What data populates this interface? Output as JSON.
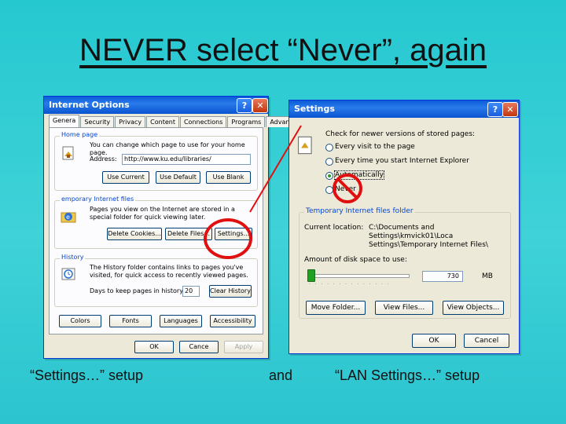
{
  "slide": {
    "title": "NEVER select “Never”, again",
    "captions": [
      "“Settings…”  setup",
      "and",
      "“LAN Settings…” setup"
    ]
  },
  "internet_options": {
    "title": "Internet Options",
    "help": "?",
    "close": "✕",
    "tabs": [
      "Genera",
      "Security",
      "Privacy",
      "Content",
      "Connections",
      "Programs",
      "Advanced"
    ],
    "home_page": {
      "label": "Home page",
      "text": "You can change which page to use for your home page.",
      "address_label": "Address:",
      "address_value": "http://www.ku.edu/libraries/",
      "buttons": [
        "Use Current",
        "Use Default",
        "Use Blank"
      ]
    },
    "temp_files": {
      "label": "emporary Internet files",
      "text": "Pages you view on the Internet are stored in a special folder for quick viewing later.",
      "buttons": [
        "Delete Cookies...",
        "Delete Files...",
        "Settings..."
      ]
    },
    "history": {
      "label": "History",
      "text": "The History folder contains links to pages you've visited, for quick access to recently viewed pages.",
      "days_label": "Days to keep pages in history:",
      "days_value": "20",
      "clear_button": "Clear History"
    },
    "bottom_buttons": [
      "Colors",
      "Fonts",
      "Languages",
      "Accessibility"
    ],
    "dialog_buttons": {
      "ok": "OK",
      "cancel": "Cance",
      "apply": "Apply"
    }
  },
  "settings": {
    "title": "Settings",
    "help": "?",
    "close": "✕",
    "check_label": "Check for newer versions of stored pages:",
    "options": [
      "Every visit to the page",
      "Every time you start Internet Explorer",
      "Automatically",
      "Never"
    ],
    "selected": "Automatically",
    "temp_group": "Temporary Internet files folder",
    "location_label": "Current location:",
    "location_value": [
      "C:\\Documents and",
      "Settings\\kmvick01\\Loca",
      "Settings\\Temporary Internet Files\\"
    ],
    "disk_label": "Amount of disk space to use:",
    "disk_value": "730",
    "disk_unit": "MB",
    "disk_fraction": 0.03,
    "folder_buttons": [
      "Move Folder...",
      "View Files...",
      "View Objects..."
    ],
    "ok": "OK",
    "cancel": "Cancel"
  },
  "colors": {
    "annotation": "#e01010",
    "xp_title": "#0a5bd8",
    "selected_radio": "#21a121"
  }
}
